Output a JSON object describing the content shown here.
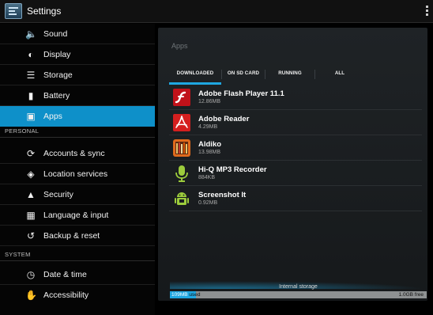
{
  "header": {
    "title": "Settings"
  },
  "sidebar": {
    "items": [
      {
        "label": "Sound",
        "icon": "sound-icon"
      },
      {
        "label": "Display",
        "icon": "display-icon"
      },
      {
        "label": "Storage",
        "icon": "storage-icon"
      },
      {
        "label": "Battery",
        "icon": "battery-icon"
      },
      {
        "label": "Apps",
        "icon": "apps-icon",
        "selected": true
      }
    ],
    "personal_header": "PERSONAL",
    "personal_items": [
      {
        "label": "Accounts & sync",
        "icon": "sync-icon"
      },
      {
        "label": "Location services",
        "icon": "location-icon"
      },
      {
        "label": "Security",
        "icon": "lock-icon"
      },
      {
        "label": "Language & input",
        "icon": "keyboard-icon"
      },
      {
        "label": "Backup & reset",
        "icon": "backup-icon"
      }
    ],
    "system_header": "SYSTEM",
    "system_items": [
      {
        "label": "Date & time",
        "icon": "clock-icon"
      },
      {
        "label": "Accessibility",
        "icon": "hand-icon"
      }
    ]
  },
  "main": {
    "title": "Apps",
    "tabs": [
      {
        "label": "DOWNLOADED",
        "active": true
      },
      {
        "label": "ON SD CARD"
      },
      {
        "label": "RUNNING"
      },
      {
        "label": "ALL"
      }
    ],
    "apps": [
      {
        "name": "Adobe Flash Player 11.1",
        "size": "12.86MB",
        "icon": "flash-player-icon"
      },
      {
        "name": "Adobe Reader",
        "size": "4.29MB",
        "icon": "adobe-reader-icon"
      },
      {
        "name": "Aldiko",
        "size": "13.98MB",
        "icon": "aldiko-icon"
      },
      {
        "name": "Hi-Q MP3 Recorder",
        "size": "884KB",
        "icon": "microphone-icon"
      },
      {
        "name": "Screenshot It",
        "size": "0.92MB",
        "icon": "android-robot-icon"
      }
    ],
    "storage": {
      "caption": "Internal storage",
      "used_value": "109MB",
      "used_suffix": " used",
      "free": "1.0GB free",
      "used_fraction": 0.1
    }
  },
  "colors": {
    "accent": "#1fa7e1",
    "selected": "#0e90c9",
    "background": "#000000"
  }
}
